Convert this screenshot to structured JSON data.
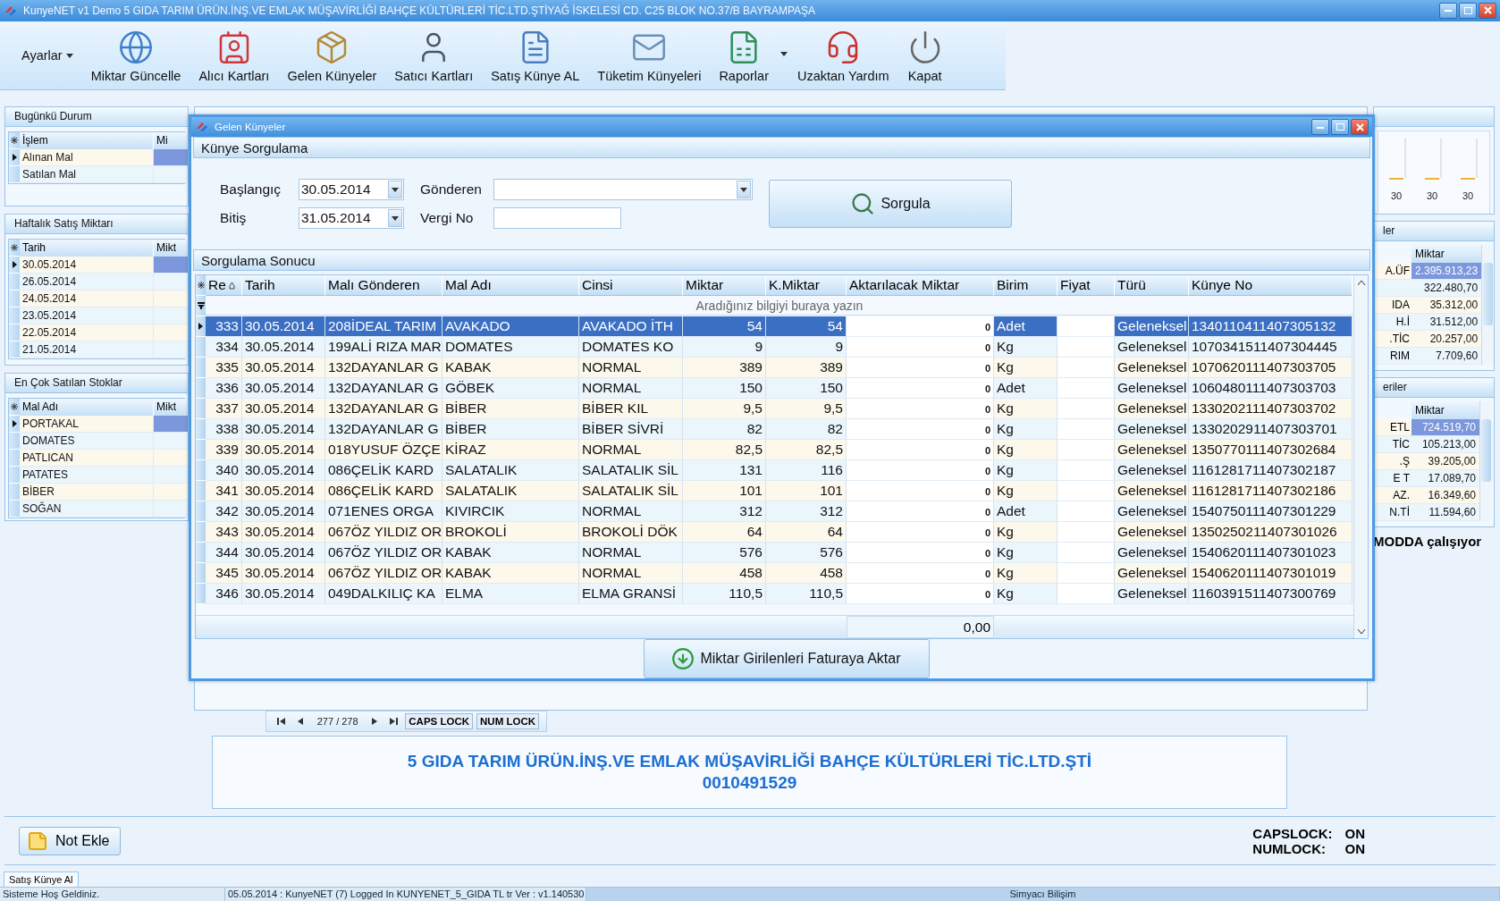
{
  "window": {
    "title": "KunyeNET v1 Demo 5 GIDA TARIM ÜRÜN.İNŞ.VE EMLAK MÜŞAVİRLİĞİ BAHÇE KÜLTÜRLERİ TİC.LTD.ŞTİYAĞ İSKELESİ  CD. C25 BLOK NO.37/B BAYRAMPAŞA"
  },
  "toolbar": [
    {
      "label": "Ayarlar",
      "kind": "menu",
      "dropdown": true
    },
    {
      "label": "Miktar Güncelle",
      "kind": "button",
      "dropdown": false
    },
    {
      "label": "Alıcı Kartları",
      "kind": "button",
      "dropdown": false
    },
    {
      "label": "Gelen Künyeler",
      "kind": "button",
      "dropdown": false
    },
    {
      "label": "Satıcı Kartları",
      "kind": "button",
      "dropdown": false
    },
    {
      "label": "Satış Künye AL",
      "kind": "button",
      "dropdown": false
    },
    {
      "label": "Tüketim Künyeleri",
      "kind": "button",
      "dropdown": false
    },
    {
      "label": "Raporlar",
      "kind": "button",
      "dropdown": true
    },
    {
      "label": "Uzaktan Yardım",
      "kind": "button",
      "dropdown": false
    },
    {
      "label": "Kapat",
      "kind": "button",
      "dropdown": false
    }
  ],
  "left_panels": [
    {
      "title": "Bugünkü Durum",
      "columns": [
        "İşlem",
        "Mi"
      ],
      "rows": [
        {
          "label": "Alınan Mal",
          "selected": true
        },
        {
          "label": "Satılan Mal",
          "selected": false
        }
      ]
    },
    {
      "title": "Haftalık Satış Miktarı",
      "columns": [
        "Tarih",
        "Mikt"
      ],
      "rows": [
        {
          "label": "30.05.2014",
          "selected": true
        },
        {
          "label": "26.05.2014",
          "selected": false
        },
        {
          "label": "24.05.2014",
          "selected": false
        },
        {
          "label": "23.05.2014",
          "selected": false
        },
        {
          "label": "22.05.2014",
          "selected": false
        },
        {
          "label": "21.05.2014",
          "selected": false
        }
      ]
    },
    {
      "title": "En Çok Satılan Stoklar",
      "columns": [
        "Mal Adı",
        "Mikt"
      ],
      "rows": [
        {
          "label": "PORTAKAL",
          "selected": true
        },
        {
          "label": "DOMATES",
          "selected": false
        },
        {
          "label": "PATLICAN",
          "selected": false
        },
        {
          "label": "PATATES",
          "selected": false
        },
        {
          "label": "BİBER",
          "selected": false
        },
        {
          "label": "SOĞAN",
          "selected": false
        }
      ]
    }
  ],
  "right_chart": {
    "labels": [
      "30",
      "30",
      "30"
    ]
  },
  "right_panels": [
    {
      "title": "ler",
      "column_2": "Miktar",
      "rows": [
        {
          "name": "A.ÜF",
          "value": "2.395.913,23",
          "selected": true
        },
        {
          "value": "322.480,70",
          "selected": false
        },
        {
          "name": "IDA",
          "value": "35.312,00",
          "selected": false
        },
        {
          "name": "H.İ",
          "value": "31.512,00",
          "selected": false
        },
        {
          "name": ".TİC",
          "value": "20.257,00",
          "selected": false
        },
        {
          "name": "RIM",
          "value": "7.709,60",
          "selected": false
        }
      ]
    },
    {
      "title": "eriler",
      "column_2": "Miktar",
      "rows": [
        {
          "name": "ETL",
          "value": "724.519,70",
          "selected": true
        },
        {
          "name": "TİC",
          "value": "105.213,00",
          "selected": false
        },
        {
          "name": ".Ş",
          "value": "39.205,00",
          "selected": false
        },
        {
          "name": "E T",
          "value": "17.089,70",
          "selected": false
        },
        {
          "name": "AZ.",
          "value": "16.349,60",
          "selected": false
        },
        {
          "name": "N.Tİ",
          "value": "11.594,60",
          "selected": false
        }
      ]
    }
  ],
  "mode_text": "MODDA çalışıyor",
  "navigator": {
    "position": "277 / 278",
    "caps": "CAPS LOCK",
    "num": "NUM LOCK"
  },
  "company": {
    "name": "5 GIDA TARIM ÜRÜN.İNŞ.VE EMLAK MÜŞAVİRLİĞİ BAHÇE KÜLTÜRLERİ TİC.LTD.ŞTİ",
    "code": "0010491529"
  },
  "note_button": "Not Ekle",
  "locks": [
    {
      "label": "CAPSLOCK:",
      "value": "ON"
    },
    {
      "label": "NUMLOCK:",
      "value": "ON"
    }
  ],
  "tabs": [
    {
      "label": "Satış Künye Al",
      "selected": true
    }
  ],
  "status_bar": {
    "message": "Sisteme Hoş Geldiniz.",
    "info": "05.05.2014 : KunyeNET (7) Logged In KUNYENET_5_GIDA TL tr Ver : v1.140530",
    "company": "Simyacı Bilişim"
  },
  "dialog": {
    "title": "Gelen Künyeler",
    "query": {
      "title": "Künye Sorgulama",
      "start_label": "Başlangıç",
      "start_value": "30.05.2014",
      "end_label": "Bitiş",
      "end_value": "31.05.2014",
      "sender_label": "Gönderen",
      "tax_label": "Vergi No",
      "button": "Sorgula"
    },
    "results_title": "Sorgulama Sonucu",
    "columns": [
      {
        "label": "Re",
        "sorted": true
      },
      {
        "label": "Tarih",
        "sorted": false
      },
      {
        "label": "Malı Gönderen",
        "sorted": false
      },
      {
        "label": "Mal Adı",
        "sorted": false
      },
      {
        "label": "Cinsi",
        "sorted": false
      },
      {
        "label": "Miktar",
        "sorted": false
      },
      {
        "label": "K.Miktar",
        "sorted": false
      },
      {
        "label": "Aktarılacak Miktar",
        "sorted": false
      },
      {
        "label": "Birim",
        "sorted": false
      },
      {
        "label": "Fiyat",
        "sorted": false
      },
      {
        "label": "Türü",
        "sorted": false
      },
      {
        "label": "Künye No",
        "sorted": false
      }
    ],
    "filter_placeholder": "Aradığınız bilgiyi buraya yazın",
    "rows": [
      {
        "re": "333",
        "tarih": "30.05.2014",
        "gonderen": "208İDEAL TARIM",
        "mal_adi": "AVAKADO",
        "cinsi": "AVAKADO İTH",
        "miktar": "54",
        "k_miktar": "54",
        "aktarilacak": "0",
        "birim": "Adet",
        "turu": "Geleneksel",
        "kunye_no": "1340110411407305132",
        "selected": true
      },
      {
        "re": "334",
        "tarih": "30.05.2014",
        "gonderen": "199ALİ RIZA MAR",
        "mal_adi": "DOMATES",
        "cinsi": "DOMATES KO",
        "miktar": "9",
        "k_miktar": "9",
        "aktarilacak": "0",
        "birim": "Kg",
        "turu": "Geleneksel",
        "kunye_no": "1070341511407304445",
        "selected": false
      },
      {
        "re": "335",
        "tarih": "30.05.2014",
        "gonderen": "132DAYANLAR G",
        "mal_adi": "KABAK",
        "cinsi": "NORMAL",
        "miktar": "389",
        "k_miktar": "389",
        "aktarilacak": "0",
        "birim": "Kg",
        "turu": "Geleneksel",
        "kunye_no": "1070620111407303705",
        "selected": false
      },
      {
        "re": "336",
        "tarih": "30.05.2014",
        "gonderen": "132DAYANLAR G",
        "mal_adi": "GÖBEK",
        "cinsi": "NORMAL",
        "miktar": "150",
        "k_miktar": "150",
        "aktarilacak": "0",
        "birim": "Adet",
        "turu": "Geleneksel",
        "kunye_no": "1060480111407303703",
        "selected": false
      },
      {
        "re": "337",
        "tarih": "30.05.2014",
        "gonderen": "132DAYANLAR G",
        "mal_adi": "BİBER",
        "cinsi": "BİBER KIL",
        "miktar": "9,5",
        "k_miktar": "9,5",
        "aktarilacak": "0",
        "birim": "Kg",
        "turu": "Geleneksel",
        "kunye_no": "1330202111407303702",
        "selected": false
      },
      {
        "re": "338",
        "tarih": "30.05.2014",
        "gonderen": "132DAYANLAR G",
        "mal_adi": "BİBER",
        "cinsi": "BİBER SİVRİ",
        "miktar": "82",
        "k_miktar": "82",
        "aktarilacak": "0",
        "birim": "Kg",
        "turu": "Geleneksel",
        "kunye_no": "1330202911407303701",
        "selected": false
      },
      {
        "re": "339",
        "tarih": "30.05.2014",
        "gonderen": "018YUSUF ÖZÇE",
        "mal_adi": "KİRAZ",
        "cinsi": "NORMAL",
        "miktar": "82,5",
        "k_miktar": "82,5",
        "aktarilacak": "0",
        "birim": "Kg",
        "turu": "Geleneksel",
        "kunye_no": "1350770111407302684",
        "selected": false
      },
      {
        "re": "340",
        "tarih": "30.05.2014",
        "gonderen": "086ÇELİK KARD",
        "mal_adi": "SALATALIK",
        "cinsi": "SALATALIK SİL",
        "miktar": "131",
        "k_miktar": "116",
        "aktarilacak": "0",
        "birim": "Kg",
        "turu": "Geleneksel",
        "kunye_no": "1161281711407302187",
        "selected": false
      },
      {
        "re": "341",
        "tarih": "30.05.2014",
        "gonderen": "086ÇELİK KARD",
        "mal_adi": "SALATALIK",
        "cinsi": "SALATALIK SİL",
        "miktar": "101",
        "k_miktar": "101",
        "aktarilacak": "0",
        "birim": "Kg",
        "turu": "Geleneksel",
        "kunye_no": "1161281711407302186",
        "selected": false
      },
      {
        "re": "342",
        "tarih": "30.05.2014",
        "gonderen": "071ENES ORGA",
        "mal_adi": "KIVIRCIK",
        "cinsi": "NORMAL",
        "miktar": "312",
        "k_miktar": "312",
        "aktarilacak": "0",
        "birim": "Adet",
        "turu": "Geleneksel",
        "kunye_no": "1540750111407301229",
        "selected": false
      },
      {
        "re": "343",
        "tarih": "30.05.2014",
        "gonderen": "067ÖZ YILDIZ OR",
        "mal_adi": "BROKOLİ",
        "cinsi": "BROKOLİ DÖK",
        "miktar": "64",
        "k_miktar": "64",
        "aktarilacak": "0",
        "birim": "Kg",
        "turu": "Geleneksel",
        "kunye_no": "1350250211407301026",
        "selected": false
      },
      {
        "re": "344",
        "tarih": "30.05.2014",
        "gonderen": "067ÖZ YILDIZ OR",
        "mal_adi": "KABAK",
        "cinsi": "NORMAL",
        "miktar": "576",
        "k_miktar": "576",
        "aktarilacak": "0",
        "birim": "Kg",
        "turu": "Geleneksel",
        "kunye_no": "1540620111407301023",
        "selected": false
      },
      {
        "re": "345",
        "tarih": "30.05.2014",
        "gonderen": "067ÖZ YILDIZ OR",
        "mal_adi": "KABAK",
        "cinsi": "NORMAL",
        "miktar": "458",
        "k_miktar": "458",
        "aktarilacak": "0",
        "birim": "Kg",
        "turu": "Geleneksel",
        "kunye_no": "1540620111407301019",
        "selected": false
      },
      {
        "re": "346",
        "tarih": "30.05.2014",
        "gonderen": "049DALKILIÇ KA",
        "mal_adi": "ELMA",
        "cinsi": "ELMA GRANSİ",
        "miktar": "110,5",
        "k_miktar": "110,5",
        "aktarilacak": "0",
        "birim": "Kg",
        "turu": "Geleneksel",
        "kunye_no": "1160391511407300769",
        "selected": false
      }
    ],
    "total": "0,00",
    "transfer_button": "Miktar Girilenleri Faturaya Aktar"
  }
}
